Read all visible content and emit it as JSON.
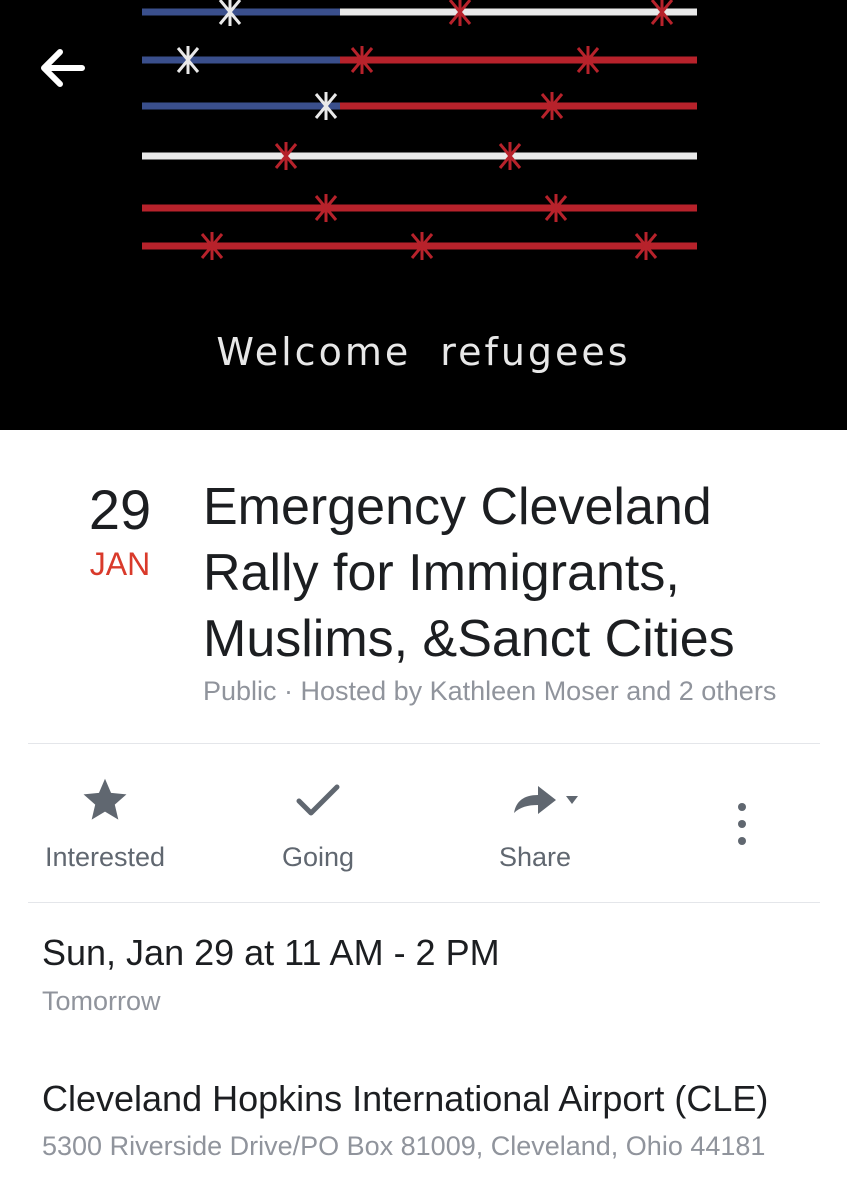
{
  "cover": {
    "caption": "Welcome refugees",
    "flag_colors": {
      "red": "#b7222b",
      "white": "#e9e9e9",
      "blue": "#3a4f8c"
    }
  },
  "event": {
    "day": "29",
    "month": "JAN",
    "title_lines": [
      "Emergency Cleveland",
      "Rally for Immigrants,",
      "Muslims, &Sanct Cities"
    ],
    "meta": "Public · Hosted by Kathleen Moser and 2 others"
  },
  "actions": {
    "interested_label": "Interested",
    "going_label": "Going",
    "share_label": "Share"
  },
  "details": {
    "when": "Sun, Jan 29 at 11 AM - 2 PM",
    "when_sub": "Tomorrow",
    "where": "Cleveland Hopkins International Airport (CLE)",
    "where_sub": "5300 Riverside Drive/PO Box 81009, Cleveland, Ohio 44181"
  },
  "icons": {
    "back": "arrow-left-icon",
    "interested": "star-icon",
    "going": "check-icon",
    "share": "share-arrow-icon",
    "more": "more-vertical-icon"
  },
  "colors": {
    "month": "#d93a2b",
    "icon": "#606770",
    "muted": "#90949c",
    "text": "#1c1e21"
  }
}
